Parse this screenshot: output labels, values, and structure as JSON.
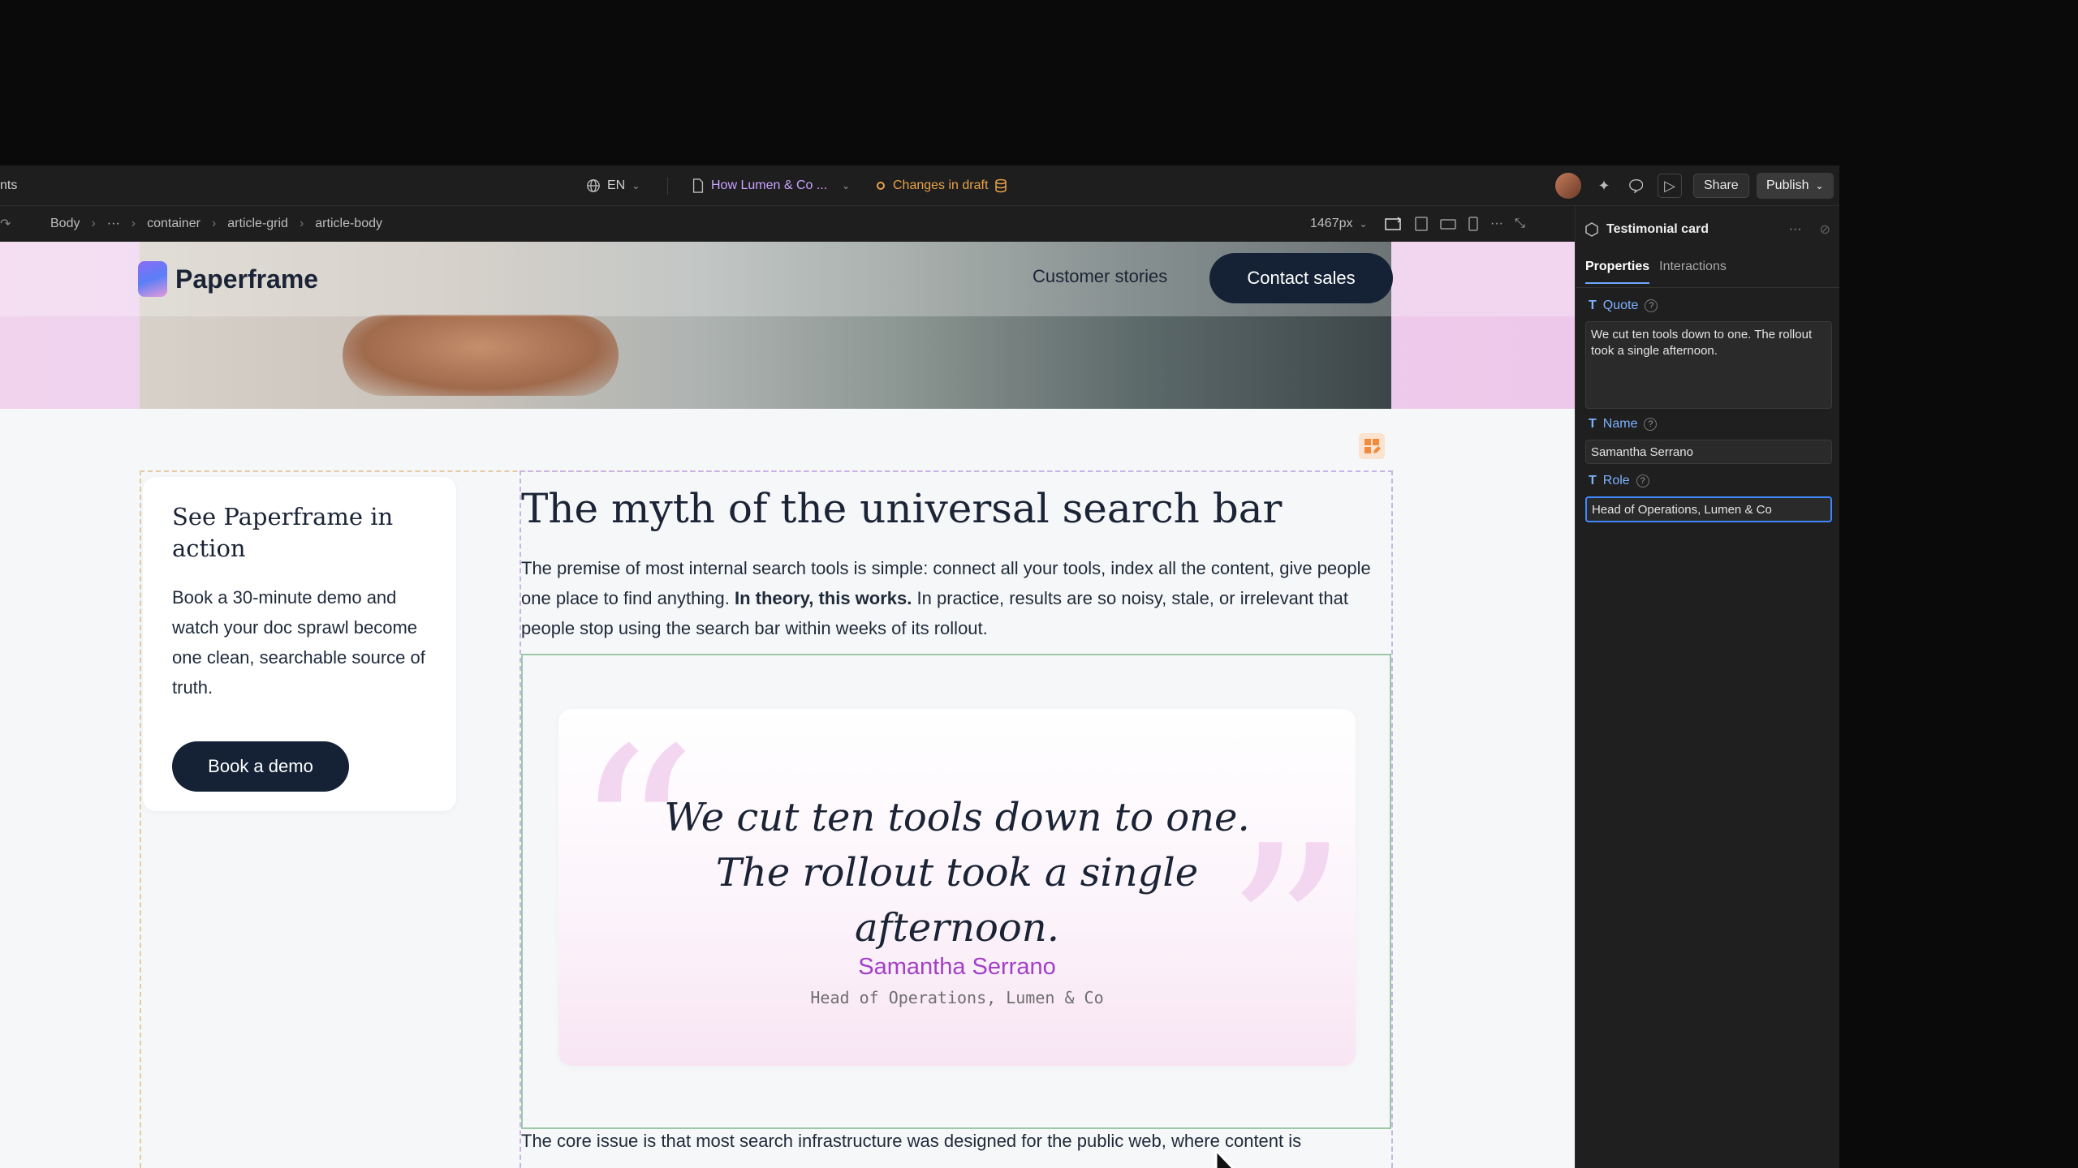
{
  "topbar": {
    "left_cut": "nts",
    "language": "EN",
    "page_name": "How Lumen & Co ...",
    "status": "Changes in draft",
    "share_label": "Share",
    "publish_label": "Publish"
  },
  "breadcrumb": {
    "items": [
      "Body",
      "···",
      "container",
      "article-grid",
      "article-body"
    ],
    "width_value": "1467px"
  },
  "site": {
    "logo_text": "Paperframe",
    "nav_link": "Customer stories",
    "contact_label": "Contact sales",
    "cta": {
      "title": "See Paperframe in action",
      "body": "Book a 30-minute demo and watch your doc sprawl become one clean, searchable source of truth.",
      "button": "Book a demo"
    },
    "article": {
      "title": "The myth of the universal search bar",
      "para_part1": "The premise of most internal search tools is simple: connect all your tools, index all the content, give people one place to find anything. ",
      "para_bold": "In theory, this works.",
      "para_part2": " In practice, results are so noisy, stale, or irrelevant that people stop using the search bar within weeks of its rollout.",
      "bottom_para": "The core issue is that most search infrastructure was designed for the public web, where content is"
    },
    "testimonial": {
      "quote": "We cut ten tools down to one. The rollout took a single afternoon.",
      "name": "Samantha Serrano",
      "role": "Head of Operations, Lumen & Co",
      "open_mark": "“",
      "close_mark": "”"
    }
  },
  "panel": {
    "title": "Testimonial card",
    "tabs": [
      "Properties",
      "Interactions"
    ],
    "fields": {
      "quote_label": "Quote",
      "quote_value": "We cut ten tools down to one. The rollout took a single afternoon.",
      "name_label": "Name",
      "name_value": "Samantha Serrano",
      "role_label": "Role",
      "role_value": "Head of Operations, Lumen & Co"
    }
  },
  "colors": {
    "accent_blue": "#3f87ff",
    "draft_orange": "#e6a24a",
    "brand_navy": "#152236",
    "name_purple": "#a23fc7"
  }
}
